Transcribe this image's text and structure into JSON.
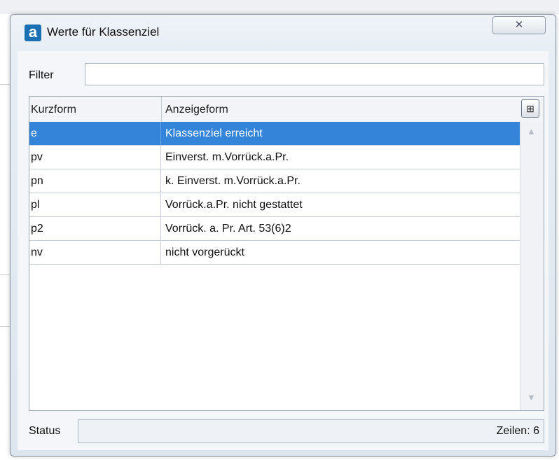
{
  "window": {
    "title": "Werte für Klassenziel",
    "app_icon_glyph": "a",
    "close_glyph": "✕"
  },
  "filter": {
    "label": "Filter",
    "value": "",
    "placeholder": ""
  },
  "grid": {
    "columns": [
      "Kurzform",
      "Anzeigeform"
    ],
    "column_chooser_glyph": "⊞",
    "rows": [
      {
        "kurzform": "e",
        "anzeigeform": "Klassenziel erreicht",
        "selected": true
      },
      {
        "kurzform": "pv",
        "anzeigeform": "Einverst. m.Vorrück.a.Pr.",
        "selected": false
      },
      {
        "kurzform": "pn",
        "anzeigeform": "k. Einverst. m.Vorrück.a.Pr.",
        "selected": false
      },
      {
        "kurzform": "pl",
        "anzeigeform": "Vorrück.a.Pr. nicht gestattet",
        "selected": false
      },
      {
        "kurzform": "p2",
        "anzeigeform": "Vorrück. a. Pr. Art. 53(6)2",
        "selected": false
      },
      {
        "kurzform": "nv",
        "anzeigeform": "nicht vorgerückt",
        "selected": false
      }
    ],
    "selection_color": "#3484d9"
  },
  "status": {
    "label": "Status",
    "rows_count": "Zeilen: 6"
  },
  "icons": {
    "scroll_up": "▲",
    "scroll_down": "▼"
  }
}
